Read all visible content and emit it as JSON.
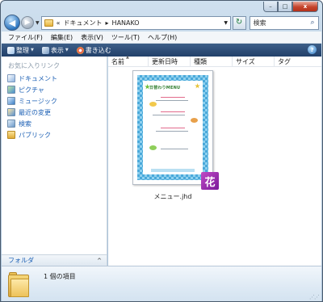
{
  "window": {
    "controls": {
      "minimize": "–",
      "maximize": "□",
      "close": "x"
    }
  },
  "address_bar": {
    "prefix": "«",
    "crumb_1": "ドキュメント",
    "separator": "▸",
    "crumb_2": "HANAKO",
    "refresh_symbol": "↻"
  },
  "search": {
    "placeholder": "検索"
  },
  "menu": [
    "ファイル(F)",
    "編集(E)",
    "表示(V)",
    "ツール(T)",
    "ヘルプ(H)"
  ],
  "commands": {
    "organize": "整理",
    "views": "表示",
    "burn": "書き込む",
    "help": "?"
  },
  "navigation": {
    "favorites_title": "お気に入りリンク",
    "favorites": [
      "ドキュメント",
      "ピクチャ",
      "ミュージック",
      "最近の変更",
      "検索",
      "パブリック"
    ],
    "folders_label": "フォルダ",
    "folders_caret": "^"
  },
  "columns": [
    "名前",
    "更新日時",
    "種類",
    "サイズ",
    "タグ"
  ],
  "files": [
    {
      "name": "メニュー.jhd",
      "thumbnail_title": "日替わりMENU",
      "app_badge_glyph": "花"
    }
  ],
  "details": {
    "item_count": "1 個の項目"
  },
  "colors": {
    "accent_blue": "#1b5fb4",
    "command_bar": "#22406a",
    "thumbnail_pattern": "#4aa9da",
    "app_badge": "#9a2fae"
  }
}
